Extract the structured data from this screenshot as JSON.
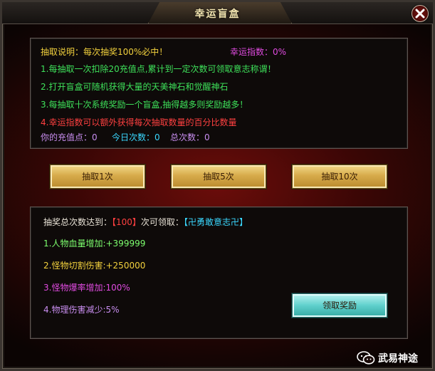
{
  "window": {
    "title": "幸运盲盒"
  },
  "info": {
    "header_label": "抽取说明：每次抽奖100%必中！",
    "luck_label": "幸运指数：0%",
    "rules": [
      "1.每抽取一次扣除20充值点,累计到一定次数可领取意志称谓！",
      "2.打开盲盒可随机获得大量的天美神石和觉醒神石",
      "3.每抽取十次系统奖励一个盲盒,抽得越多则奖励越多！",
      "4.幸运指数可以额外获得每次抽取数量的百分比数量"
    ],
    "points_label": "你的充值点：0",
    "today_label": "今日次数：0",
    "total_label": "总次数：0"
  },
  "buttons": {
    "draw1": "抽取1次",
    "draw5": "抽取5次",
    "draw10": "抽取10次",
    "claim": "领取奖励"
  },
  "reward": {
    "prefix": "抽奖总次数达到：",
    "count": "【100】",
    "mid": "次可领取：",
    "title": "【卍勇敢意志卍】",
    "stats": [
      "1.人物血量增加:+399999",
      "2.怪物切割伤害:+250000",
      "3.怪物爆率增加:100%",
      "4.物理伤害减少:5%"
    ]
  },
  "watermark": {
    "text": "武易神途",
    "icon": "wechat-icon"
  },
  "colors": {
    "yellow": "#f2d13d",
    "green": "#3ee15a",
    "pink": "#e04be0",
    "red": "#ff4040",
    "cyan": "#3ad8ff",
    "gold_button": "#d7ab4b",
    "teal_button": "#5fd0cc"
  }
}
